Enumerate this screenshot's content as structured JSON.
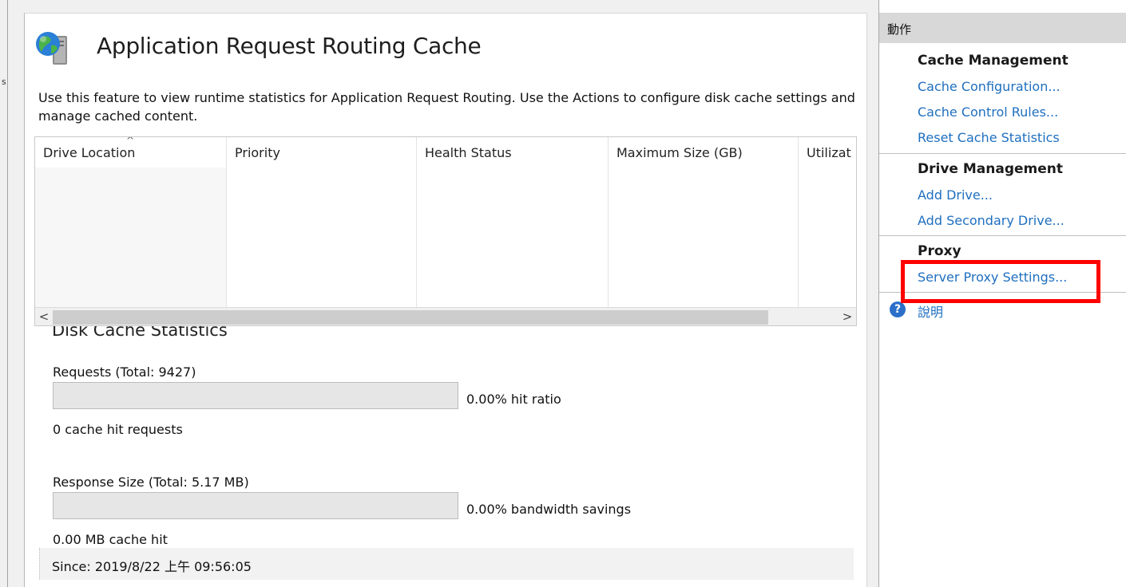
{
  "page": {
    "title": "Application Request Routing Cache",
    "description": "Use this feature to view runtime statistics for Application Request Routing.  Use the Actions to configure disk cache settings and manage cached content."
  },
  "grid": {
    "sort_indicator": "^",
    "columns": [
      "Drive Location",
      "Priority",
      "Health Status",
      "Maximum Size (GB)",
      "Utilizat"
    ],
    "rows": []
  },
  "scrollbar": {
    "left_arrow": "<",
    "right_arrow": ">"
  },
  "stats": {
    "section_title": "Disk Cache Statistics",
    "requests_label": "Requests (Total: 9427)",
    "requests_ratio": "0.00% hit ratio",
    "requests_hits": "0 cache hit requests",
    "requests_fill_fraction": 0,
    "response_label": "Response Size (Total: 5.17 MB)",
    "response_ratio": "0.00% bandwidth savings",
    "response_hits": "0.00 MB cache hit",
    "response_fill_fraction": 0,
    "since": "Since: 2019/8/22 上午 09:56:05"
  },
  "actions": {
    "header": "動作",
    "cache_management": {
      "title": "Cache Management",
      "links": [
        "Cache Configuration...",
        "Cache Control Rules...",
        "Reset Cache Statistics"
      ]
    },
    "drive_management": {
      "title": "Drive Management",
      "links": [
        "Add Drive...",
        "Add Secondary Drive..."
      ]
    },
    "proxy": {
      "title": "Proxy",
      "links": [
        "Server Proxy Settings..."
      ]
    },
    "help": {
      "icon": "?",
      "label": "說明"
    }
  },
  "colors": {
    "link": "#1f6fbf",
    "highlight": "#ff0000",
    "bar_fill": "#06b025"
  },
  "icons": {
    "feature": "globe-server-icon",
    "help": "help-icon"
  }
}
